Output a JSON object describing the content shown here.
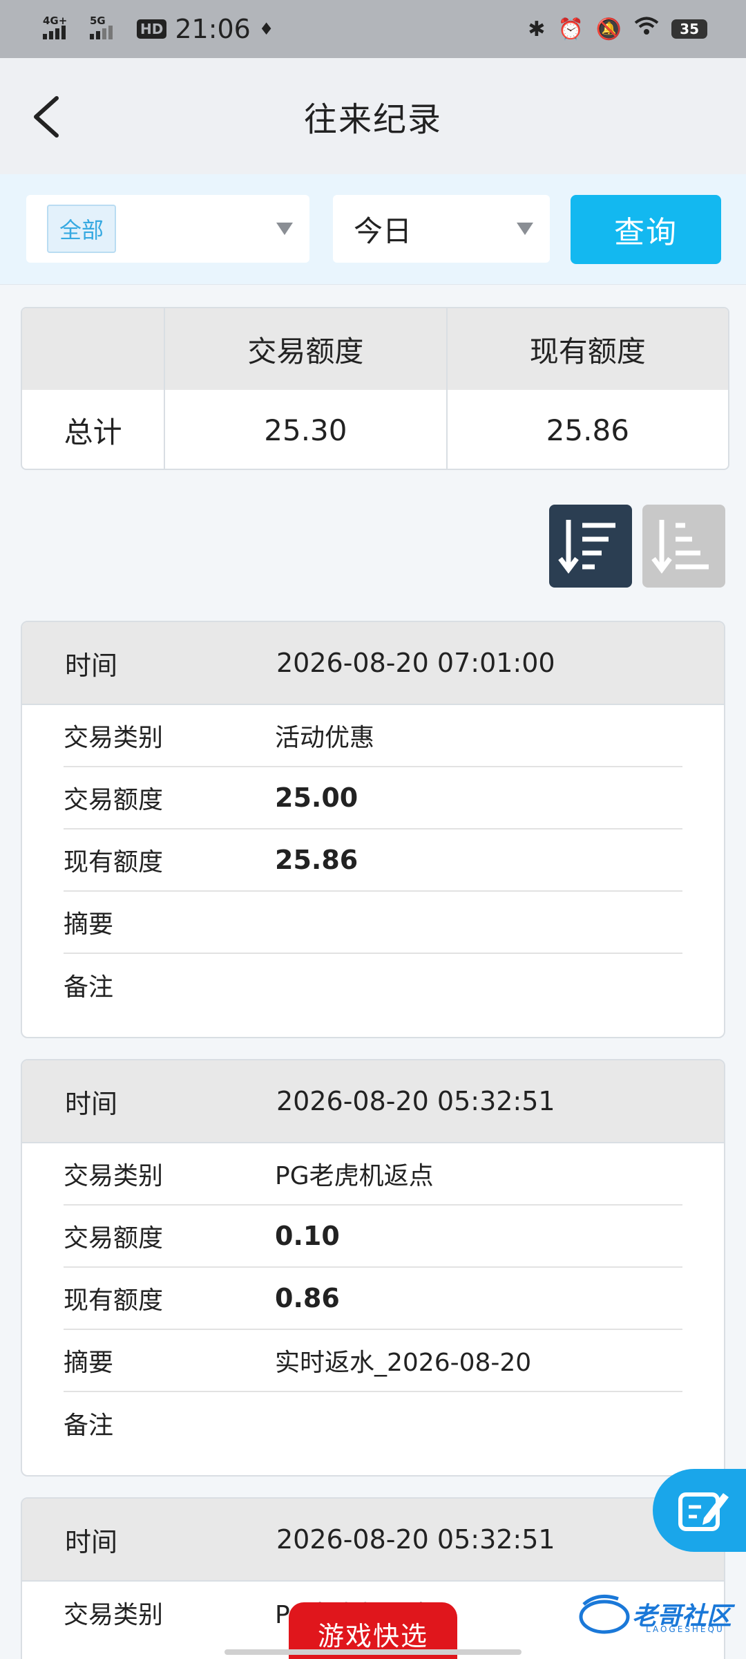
{
  "status_bar": {
    "network1": "4G+",
    "network2": "5G",
    "hd": "HD",
    "time": "21:06",
    "battery": "35"
  },
  "header": {
    "title": "往来纪录"
  },
  "filter": {
    "type_value": "全部",
    "period_value": "今日",
    "query_label": "查询"
  },
  "summary": {
    "headers": [
      "",
      "交易额度",
      "现有额度"
    ],
    "row_label": "总计",
    "trade_amount": "25.30",
    "current_amount": "25.86"
  },
  "records": [
    {
      "time_label": "时间",
      "time": "2026-08-20 07:01:00",
      "type_label": "交易类别",
      "type": "活动优惠",
      "amount_label": "交易额度",
      "amount": "25.00",
      "balance_label": "现有额度",
      "balance": "25.86",
      "summary_label": "摘要",
      "summary": "",
      "note_label": "备注",
      "note": ""
    },
    {
      "time_label": "时间",
      "time": "2026-08-20 05:32:51",
      "type_label": "交易类别",
      "type": "PG老虎机返点",
      "amount_label": "交易额度",
      "amount": "0.10",
      "balance_label": "现有额度",
      "balance": "0.86",
      "summary_label": "摘要",
      "summary": "实时返水_2026-08-20",
      "note_label": "备注",
      "note": ""
    },
    {
      "time_label": "时间",
      "time": "2026-08-20 05:32:51",
      "type_label": "交易类别",
      "type": "PG老虎机返点"
    }
  ],
  "floating": {
    "game_quick_label": "游戏快选",
    "watermark": "老哥社区",
    "watermark_sub": "LAOGESHEQU"
  },
  "colors": {
    "accent": "#13b8f0",
    "sort_active": "#2b3e52",
    "sort_inactive": "#c8c8c8",
    "game_button": "#e0161c"
  }
}
